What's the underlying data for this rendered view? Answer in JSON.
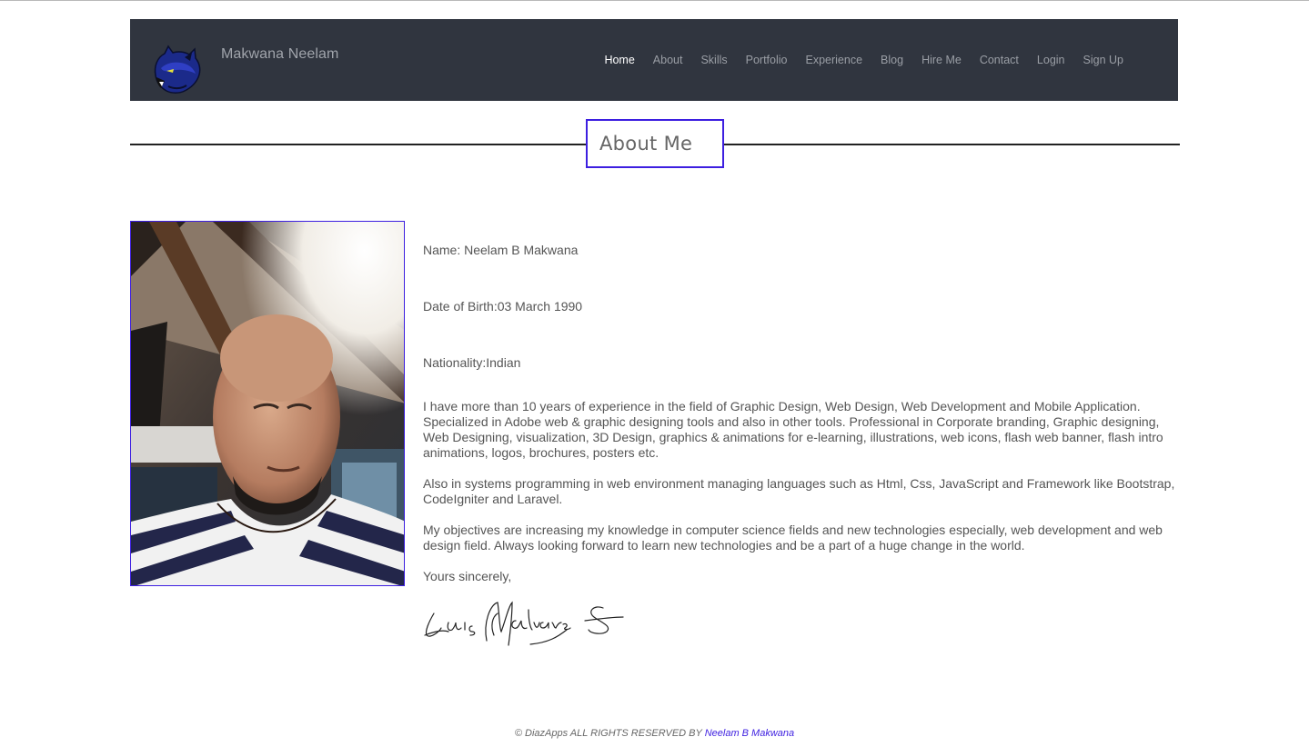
{
  "brand": {
    "name": "Makwana Neelam",
    "logo_icon": "panther-logo-icon"
  },
  "nav": {
    "items": [
      {
        "label": "Home",
        "active": true
      },
      {
        "label": "About"
      },
      {
        "label": "Skills"
      },
      {
        "label": "Portfolio"
      },
      {
        "label": "Experience"
      },
      {
        "label": "Blog"
      },
      {
        "label": "Hire Me"
      },
      {
        "label": "Contact"
      },
      {
        "label": "Login"
      },
      {
        "label": "Sign Up"
      }
    ]
  },
  "about": {
    "title": "About Me",
    "name": "Name: Neelam B Makwana",
    "dob": "Date of Birth:03 March 1990",
    "nationality": "Nationality:Indian",
    "paragraphs": [
      "I have more than 10 years of experience in the field of Graphic Design, Web Design, Web Development and Mobile Application. Specialized in Adobe web & graphic designing tools and also in other tools. Professional in Corporate branding, Graphic designing, Web Designing, visualization, 3D Design, graphics & animations for e-learning, illustrations, web icons, flash web banner, flash intro animations, logos, brochures, posters etc.",
      "Also in systems programming in web environment managing languages such as Html, Css, JavaScript and Framework like Bootstrap, CodeIgniter and Laravel.",
      "My objectives are increasing my knowledge in computer science fields and new technologies especially, web development and web design field. Always looking forward to learn new technologies and be a part of a huge change in the world.",
      "Yours sincerely,"
    ],
    "signature": "Luis M Alvarez S"
  },
  "footer": {
    "text": "© DiazApps ALL RIGHTS RESERVED BY ",
    "link": "Neelam B Makwana"
  },
  "colors": {
    "navbar": "#30353f",
    "accent": "#3d1fe0",
    "text": "#555555"
  }
}
